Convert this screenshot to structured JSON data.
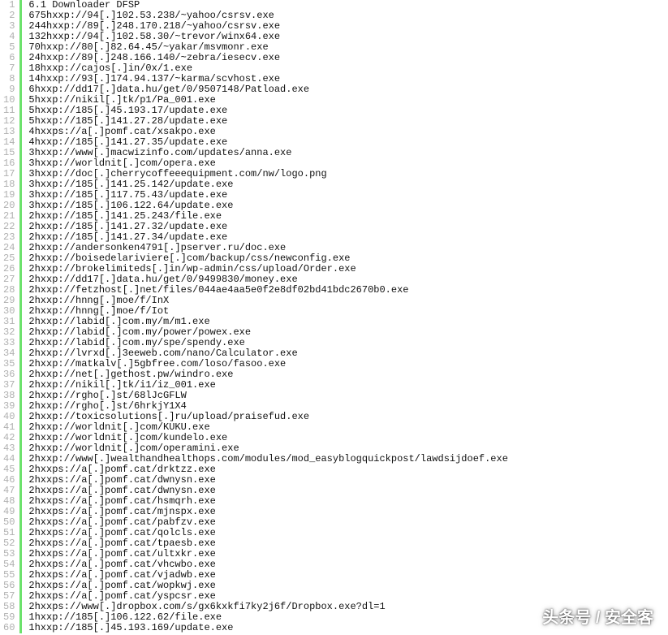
{
  "watermark": "头条号 / 安全客",
  "lines": [
    "6.1 Downloader DFSP",
    "675hxxp://94[.]102.53.238/~yahoo/csrsv.exe",
    "244hxxp://89[.]248.170.218/~yahoo/csrsv.exe",
    "132hxxp://94[.]102.58.30/~trevor/winx64.exe",
    "70hxxp://80[.]82.64.45/~yakar/msvmonr.exe",
    "24hxxp://89[.]248.166.140/~zebra/iesecv.exe",
    "18hxxp://cajos[.]in/0x/1.exe",
    "14hxxp://93[.]174.94.137/~karma/scvhost.exe",
    "6hxxp://dd17[.]data.hu/get/0/9507148/Patload.exe",
    "5hxxp://nikil[.]tk/p1/Pa_001.exe",
    "5hxxp://185[.]45.193.17/update.exe",
    "5hxxp://185[.]141.27.28/update.exe",
    "4hxxps://a[.]pomf.cat/xsakpo.exe",
    "4hxxp://185[.]141.27.35/update.exe",
    "3hxxp://www[.]macwizinfo.com/updates/anna.exe",
    "3hxxp://worldnit[.]com/opera.exe",
    "3hxxp://doc[.]cherrycoffeeequipment.com/nw/logo.png",
    "3hxxp://185[.]141.25.142/update.exe",
    "3hxxp://185[.]117.75.43/update.exe",
    "3hxxp://185[.]106.122.64/update.exe",
    "2hxxp://185[.]141.25.243/file.exe",
    "2hxxp://185[.]141.27.32/update.exe",
    "2hxxp://185[.]141.27.34/update.exe",
    "2hxxp://andersonken4791[.]pserver.ru/doc.exe",
    "2hxxp://boisedelariviere[.]com/backup/css/newconfig.exe",
    "2hxxp://brokelimiteds[.]in/wp-admin/css/upload/Order.exe",
    "2hxxp://dd17[.]data.hu/get/0/9499830/money.exe",
    "2hxxp://fetzhost[.]net/files/044ae4aa5e0f2e8df02bd41bdc2670b0.exe",
    "2hxxp://hnng[.]moe/f/InX",
    "2hxxp://hnng[.]moe/f/Iot",
    "2hxxp://labid[.]com.my/m/m1.exe",
    "2hxxp://labid[.]com.my/power/powex.exe",
    "2hxxp://labid[.]com.my/spe/spendy.exe",
    "2hxxp://lvrxd[.]3eeweb.com/nano/Calculator.exe",
    "2hxxp://matkalv[.]5gbfree.com/loso/fasoo.exe",
    "2hxxp://net[.]gethost.pw/windro.exe",
    "2hxxp://nikil[.]tk/i1/iz_001.exe",
    "2hxxp://rgho[.]st/68lJcGFLW",
    "2hxxp://rgho[.]st/6hrkjY1X4",
    "2hxxp://toxicsolutions[.]ru/upload/praisefud.exe",
    "2hxxp://worldnit[.]com/KUKU.exe",
    "2hxxp://worldnit[.]com/kundelo.exe",
    "2hxxp://worldnit[.]com/operamini.exe",
    "2hxxp://www[.]wealthandhealthops.com/modules/mod_easyblogquickpost/lawdsijdoef.exe",
    "2hxxps://a[.]pomf.cat/drktzz.exe",
    "2hxxps://a[.]pomf.cat/dwnysn.exe",
    "2hxxps://a[.]pomf.cat/dwnysn.exe",
    "2hxxps://a[.]pomf.cat/hsmqrh.exe",
    "2hxxps://a[.]pomf.cat/mjnspx.exe",
    "2hxxps://a[.]pomf.cat/pabfzv.exe",
    "2hxxps://a[.]pomf.cat/qolcls.exe",
    "2hxxps://a[.]pomf.cat/tpaesb.exe",
    "2hxxps://a[.]pomf.cat/ultxkr.exe",
    "2hxxps://a[.]pomf.cat/vhcwbo.exe",
    "2hxxps://a[.]pomf.cat/vjadwb.exe",
    "2hxxps://a[.]pomf.cat/wopkwj.exe",
    "2hxxps://a[.]pomf.cat/yspcsr.exe",
    "2hxxps://www[.]dropbox.com/s/gx6kxkfi7ky2j6f/Dropbox.exe?dl=1",
    "1hxxp://185[.]106.122.62/file.exe",
    "1hxxp://185[.]45.193.169/update.exe"
  ]
}
